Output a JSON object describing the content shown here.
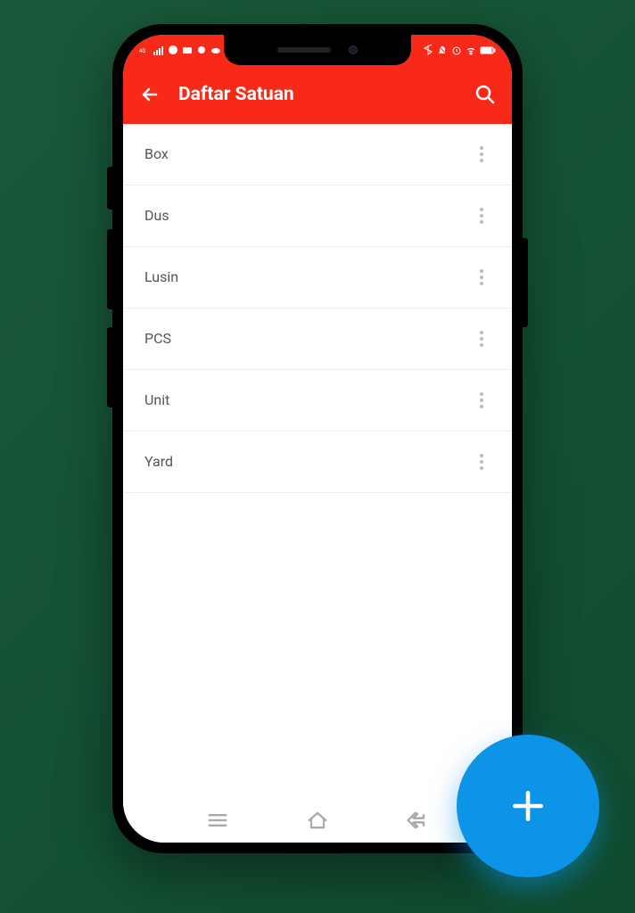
{
  "app_bar": {
    "title": "Daftar Satuan"
  },
  "list": {
    "items": [
      {
        "label": "Box"
      },
      {
        "label": "Dus"
      },
      {
        "label": "Lusin"
      },
      {
        "label": "PCS"
      },
      {
        "label": "Unit"
      },
      {
        "label": "Yard"
      }
    ]
  },
  "colors": {
    "primary": "#f82919",
    "fab": "#0b94e8"
  }
}
